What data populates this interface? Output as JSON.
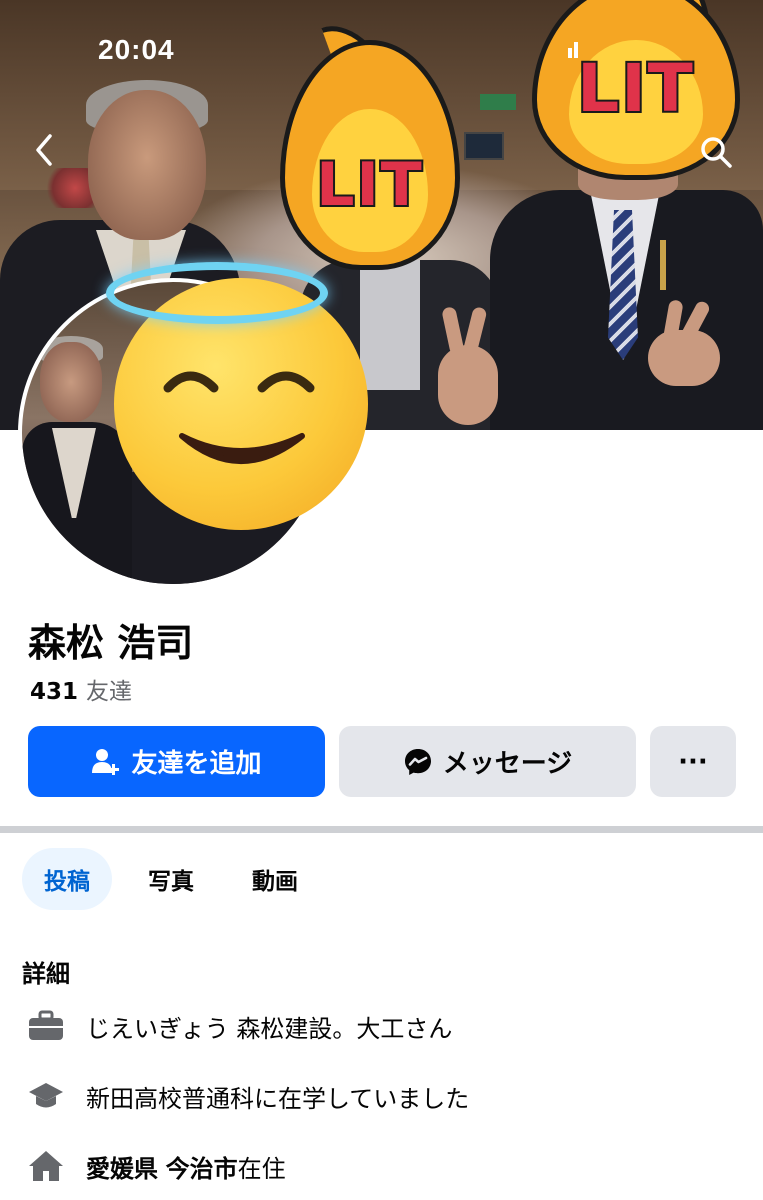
{
  "status_bar": {
    "time": "20:04"
  },
  "cover": {
    "stickers": [
      "LIT",
      "LIT"
    ]
  },
  "profile": {
    "name": "森松 浩司",
    "friends_count": "431",
    "friends_label": "友達"
  },
  "actions": {
    "add_friend": "友達を追加",
    "message": "メッセージ",
    "more": "···"
  },
  "tabs": [
    {
      "label": "投稿",
      "selected": true
    },
    {
      "label": "写真",
      "selected": false
    },
    {
      "label": "動画",
      "selected": false
    }
  ],
  "details": {
    "title": "詳細",
    "work": "じえいぎょう 森松建設。大工さん",
    "education": "新田高校普通科に在学していました",
    "home_prefecture": "愛媛県",
    "home_city": "今治市",
    "home_suffix": "在住"
  },
  "colors": {
    "primary_blue": "#0866ff",
    "secondary_button": "#e4e6eb",
    "selected_tab_bg": "#ebf5ff",
    "selected_tab_text": "#0064d1",
    "secondary_text": "#65676b"
  },
  "icons": {
    "back": "chevron-left-icon",
    "search": "search-icon",
    "add_friend": "person-add-icon",
    "message": "messenger-icon",
    "work": "briefcase-icon",
    "education": "graduation-cap-icon",
    "home": "house-icon"
  }
}
